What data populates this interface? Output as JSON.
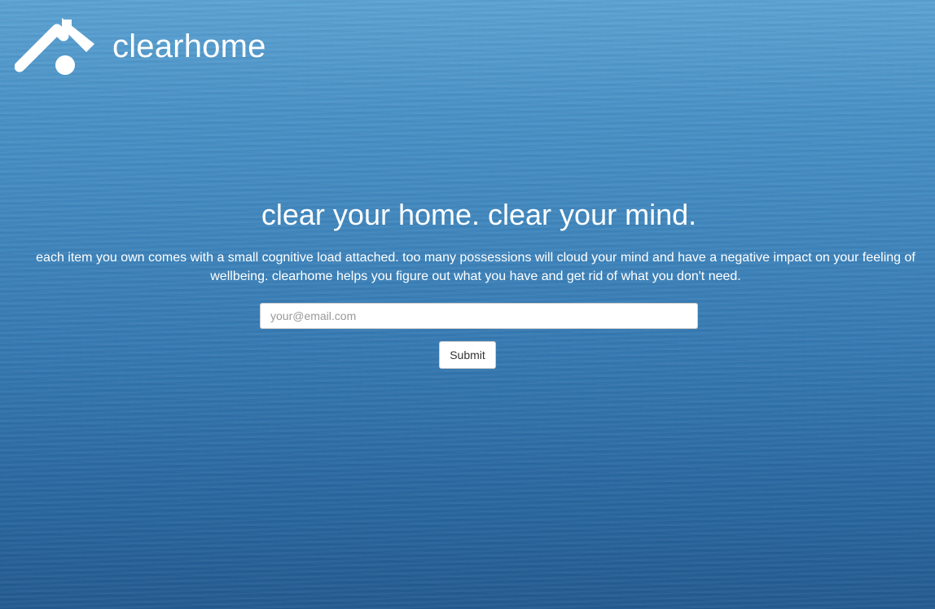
{
  "brand": {
    "name": "clearhome",
    "logo_icon": "house-icon"
  },
  "hero": {
    "headline": "clear your home. clear your mind.",
    "description": "each item you own comes with a small cognitive load attached. too many possessions will cloud your mind and have a negative impact on your feeling of wellbeing. clearhome helps you figure out what you have and get rid of what you don't need."
  },
  "form": {
    "email_value": "",
    "email_placeholder": "your@email.com",
    "submit_label": "Submit"
  },
  "colors": {
    "background_top": "#5ba3d3",
    "background_bottom": "#235b91",
    "text": "#ffffff"
  }
}
